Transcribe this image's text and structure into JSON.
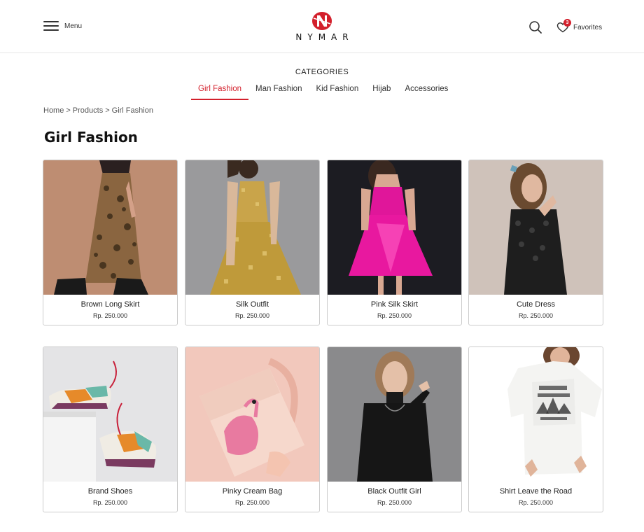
{
  "header": {
    "menu_label": "Menu",
    "brand": "NYMAR",
    "favorites_label": "Favorites",
    "favorites_count": "3",
    "accent_color": "#d3202c"
  },
  "categories": {
    "title": "CATEGORIES",
    "tabs": [
      {
        "label": "Girl Fashion",
        "active": true
      },
      {
        "label": "Man Fashion",
        "active": false
      },
      {
        "label": "Kid Fashion",
        "active": false
      },
      {
        "label": "Hijab",
        "active": false
      },
      {
        "label": "Accessories",
        "active": false
      }
    ]
  },
  "breadcrumb": [
    "Home",
    "Products",
    "Girl Fashion"
  ],
  "breadcrumb_separator": ">",
  "page_title": "Girl Fashion",
  "products": [
    {
      "name": "Brown Long Skirt",
      "price": "Rp. 250.000"
    },
    {
      "name": "Silk Outfit",
      "price": "Rp. 250.000"
    },
    {
      "name": "Pink Silk Skirt",
      "price": "Rp. 250.000"
    },
    {
      "name": "Cute Dress",
      "price": "Rp. 250.000"
    },
    {
      "name": "Brand Shoes",
      "price": "Rp. 250.000"
    },
    {
      "name": "Pinky Cream Bag",
      "price": "Rp. 250.000"
    },
    {
      "name": "Black Outfit Girl",
      "price": "Rp. 250.000"
    },
    {
      "name": "Shirt Leave the Road",
      "price": "Rp. 250.000"
    }
  ]
}
